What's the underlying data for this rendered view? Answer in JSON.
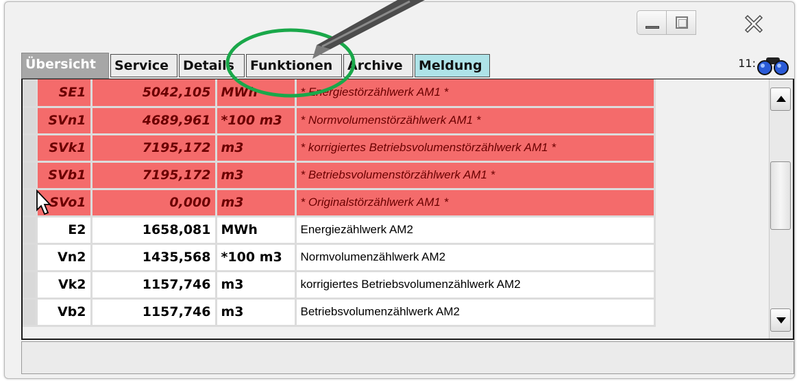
{
  "window": {
    "controls": {
      "minimize": "minimize-icon",
      "maximize": "maximize-icon",
      "close": "close-icon"
    }
  },
  "tabs": [
    {
      "label": "Übersicht",
      "active": true
    },
    {
      "label": "Service"
    },
    {
      "label": "Details"
    },
    {
      "label": "Funktionen"
    },
    {
      "label": "Archive"
    },
    {
      "label": "Meldung",
      "color": "#aee3e8"
    }
  ],
  "header": {
    "time": "11:",
    "binoculars_icon": "binoculars-icon"
  },
  "rows": [
    {
      "name": "SE1",
      "value": "5042,105",
      "unit": "MWh",
      "desc": "* Energiestörzählwerk AM1 *",
      "state": "alarm"
    },
    {
      "name": "SVn1",
      "value": "4689,961",
      "unit": "*100 m3",
      "desc": "* Normvolumenstörzählwerk AM1 *",
      "state": "alarm"
    },
    {
      "name": "SVk1",
      "value": "7195,172",
      "unit": "m3",
      "desc": "* korrigiertes Betriebsvolumenstörzählwerk AM1 *",
      "state": "alarm"
    },
    {
      "name": "SVb1",
      "value": "7195,172",
      "unit": "m3",
      "desc": "* Betriebsvolumenstörzählwerk AM1 *",
      "state": "alarm"
    },
    {
      "name": "SVo1",
      "value": "0,000",
      "unit": "m3",
      "desc": "* Originalstörzählwerk AM1 *",
      "state": "alarm"
    },
    {
      "name": "E2",
      "value": "1658,081",
      "unit": "MWh",
      "desc": "Energiezählwerk AM2",
      "state": "normal"
    },
    {
      "name": "Vn2",
      "value": "1435,568",
      "unit": "*100 m3",
      "desc": "Normvolumenzählwerk AM2",
      "state": "normal"
    },
    {
      "name": "Vk2",
      "value": "1157,746",
      "unit": "m3",
      "desc": "korrigiertes Betriebsvolumenzählwerk AM2",
      "state": "normal"
    },
    {
      "name": "Vb2",
      "value": "1157,746",
      "unit": "m3",
      "desc": "Betriebsvolumenzählwerk AM2",
      "state": "normal"
    }
  ],
  "colors": {
    "alarm_row": "#f46b6b",
    "highlight_circle": "#1aa84a",
    "meldung_tab": "#aee3e8"
  },
  "status": {
    "text": ""
  }
}
